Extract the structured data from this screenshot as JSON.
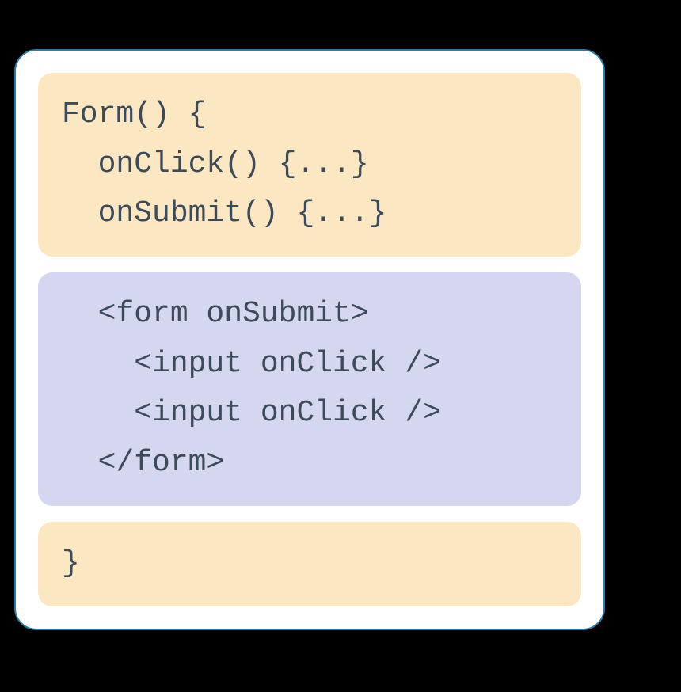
{
  "blocks": {
    "top": "Form() {\n  onClick() {...}\n  onSubmit() {...}",
    "middle": "  <form onSubmit>\n    <input onClick />\n    <input onClick />\n  </form>",
    "bottom": "}"
  }
}
